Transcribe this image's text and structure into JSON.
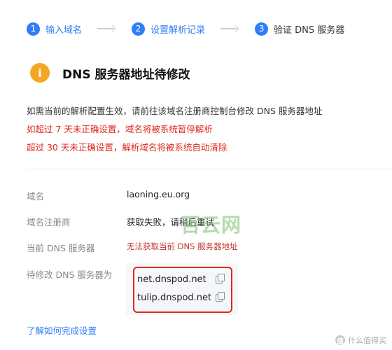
{
  "steps": [
    {
      "num": "1",
      "label": "输入域名"
    },
    {
      "num": "2",
      "label": "设置解析记录"
    },
    {
      "num": "3",
      "label": "验证 DNS 服务器"
    }
  ],
  "header": {
    "icon": "exclamation-icon",
    "icon_glyph": "i",
    "icon_color": "#f5a623",
    "title": "DNS 服务器地址待修改"
  },
  "notices": {
    "info": "如需当前的解析配置生效，请前往该域名注册商控制台修改 DNS 服务器地址",
    "warning_7": "如超过 7 天未正确设置，域名将被系统暂停解析",
    "warning_30": "超过 30 天未正确设置，解析域名将被系统自动清除"
  },
  "fields": {
    "domain_label": "域名",
    "domain_value": "laoning.eu.org",
    "registrar_label": "域名注册商",
    "registrar_value": "获取失败，请稍后重试",
    "current_dns_label": "当前 DNS 服务器",
    "current_dns_value": "无法获取当前 DNS 服务器地址",
    "pending_dns_label": "待修改 DNS 服务器为"
  },
  "nameservers": [
    "net.dnspod.net",
    "tulip.dnspod.net"
  ],
  "help_link": "了解如何完成设置",
  "watermark": "百云网",
  "site_logo": {
    "badge": "值",
    "text": "什么值得买"
  },
  "colors": {
    "accent": "#2f7cf6",
    "warning": "#e0281e",
    "error": "#c0392b"
  }
}
